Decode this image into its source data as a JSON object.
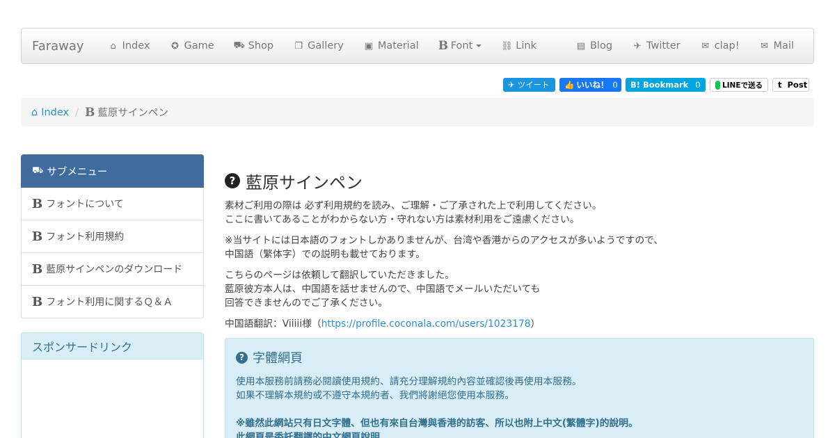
{
  "nav": {
    "brand": "Faraway",
    "left": [
      {
        "label": "Index",
        "icon": "home-icon",
        "glyph": "⌂"
      },
      {
        "label": "Game",
        "icon": "gamepad-icon",
        "glyph": "✪"
      },
      {
        "label": "Shop",
        "icon": "cart-icon",
        "glyph": "⛟"
      },
      {
        "label": "Gallery",
        "icon": "gallery-icon",
        "glyph": "❐"
      },
      {
        "label": "Material",
        "icon": "picture-icon",
        "glyph": "▣"
      },
      {
        "label": "Font",
        "icon": "bold-icon",
        "glyph": "B"
      },
      {
        "label": "Link",
        "icon": "link-icon",
        "glyph": "⛓"
      }
    ],
    "right": [
      {
        "label": "Blog",
        "icon": "blog-icon",
        "glyph": "▤"
      },
      {
        "label": "Twitter",
        "icon": "twitter-icon",
        "glyph": "✈"
      },
      {
        "label": "clap!",
        "icon": "envelope-icon",
        "glyph": "✉"
      },
      {
        "label": "Mail",
        "icon": "mail-icon",
        "glyph": "✉"
      }
    ]
  },
  "share": {
    "tweet": "ツイート",
    "like": "いいね！",
    "like_count": "0",
    "bookmark": "B! Bookmark",
    "bookmark_count": "0",
    "line": "LINEで送る",
    "tumblr": "t  Post"
  },
  "breadcrumb": {
    "home": "Index",
    "current": "藍原サインペン"
  },
  "sidebar": {
    "heading": "サブメニュー",
    "items": [
      "フォントについて",
      "フォント利用規約",
      "藍原サインペンのダウンロード",
      "フォント利用に関するＱ＆Ａ"
    ],
    "sponsor": "スポンサードリンク"
  },
  "main": {
    "title": "藍原サインペン",
    "p1_l1": "素材ご利用の際は 必ず利用規約を読み、ご理解・ご了承された上で利用してください。",
    "p1_l2": "ここに書いてあることがわからない方・守れない方は素材利用をご遠慮ください。",
    "p2_l1": "※当サイトには日本語のフォントしかありませんが、台湾や香港からのアクセスが多いようですので、",
    "p2_l2": "中国語（繁体字）での説明も載せております。",
    "p3_l1": "こちらのページは依頼して翻訳していただきました。",
    "p3_l2": "藍原彼方本人は、中国語を話せませんので、中国語でメールいただいても",
    "p3_l3": "回答できませんのでご了承ください。",
    "translator_prefix": "中国語翻訳：Viiiii様（",
    "translator_link": "https://profile.coconala.com/users/1023178",
    "translator_suffix": "）"
  },
  "info": {
    "title": "字體網頁",
    "l1": "使用本服務前請務必閱讀使用規約、請充分理解規約內容並確認後再使用本服務。",
    "l2": "如果不理解本規約或不遵守本規約者、我們將謝絕您使用本服務。",
    "l3": "※雖然此網站只有日文字體、但也有來自台灣與香港的訪客、所以也附上中文(繁體字)的說明。",
    "l4": "此網頁是委託翻譯的中文網頁說明"
  }
}
